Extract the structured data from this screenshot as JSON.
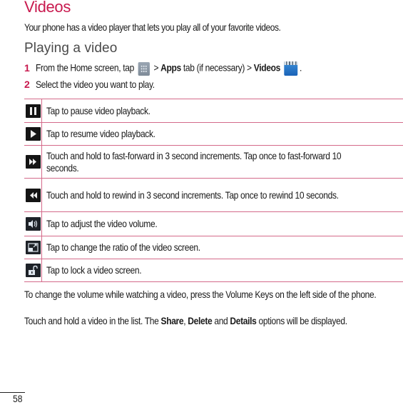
{
  "page": {
    "title": "Videos",
    "intro": "Your phone has a video player that lets you play all of your favorite videos.",
    "subtitle": "Playing a video",
    "colors": {
      "accent": "#c8194e",
      "table_border": "#d46a8a",
      "subtitle": "#4a4a4a",
      "text": "#1a1a1a"
    },
    "steps": [
      {
        "number": "1",
        "parts": {
          "a": "From the Home screen, tap",
          "apps_icon": "apps-grid-icon",
          "b": " > ",
          "apps": "Apps",
          "c": " tab (if necessary) > ",
          "videos": "Videos",
          "videos_icon": "videos-app-icon",
          "d": "."
        }
      },
      {
        "number": "2",
        "text": "Select the video you want to play."
      }
    ],
    "controls": [
      {
        "icon": "pause-icon",
        "description": "Tap to pause video playback."
      },
      {
        "icon": "play-icon",
        "description": "Tap to resume video playback."
      },
      {
        "icon": "fast-forward-icon",
        "description": "Touch and hold to fast-forward in 3 second increments. Tap once to fast-forward 10 seconds."
      },
      {
        "icon": "rewind-icon",
        "description": "Touch and hold to rewind in 3 second increments. Tap once to rewind 10 seconds."
      },
      {
        "icon": "volume-icon",
        "description": "Tap to adjust the video volume."
      },
      {
        "icon": "screen-ratio-icon",
        "description": "Tap to change the ratio of the video screen."
      },
      {
        "icon": "lock-icon",
        "description": "Tap to lock a video screen."
      }
    ],
    "para1": "To change the volume while watching a video, press the Volume Keys on the left side of the phone.",
    "para2": {
      "a": "Touch and hold a video in the list. The ",
      "share": "Share",
      "sep1": ", ",
      "delete": "Delete",
      "sep2": " and ",
      "details": "Details",
      "b": " options will be displayed."
    },
    "page_number": "58"
  }
}
